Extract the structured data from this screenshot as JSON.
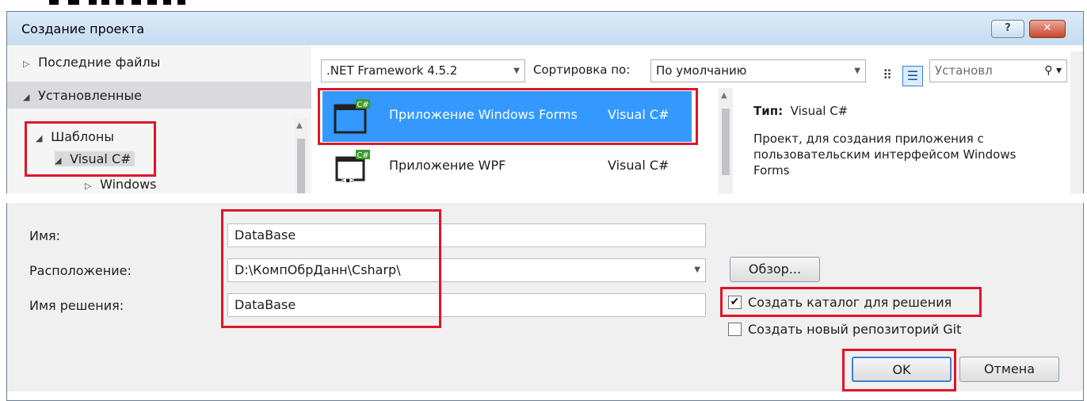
{
  "dialog": {
    "title": "Создание проекта",
    "help_glyph": "?",
    "close_glyph": "✕"
  },
  "sidebar": {
    "items": [
      {
        "label": "Последние файлы",
        "expander": "▷"
      },
      {
        "label": "Установленные",
        "expander": "◢"
      },
      {
        "label": "Шаблоны",
        "expander": "◢"
      },
      {
        "label": "Visual C#",
        "expander": "◢"
      },
      {
        "label": "Windows",
        "expander": "▷"
      }
    ]
  },
  "toolbar": {
    "framework": ".NET Framework 4.5.2",
    "sort_label": "Сортировка по:",
    "sort_value": "По умолчанию",
    "search_placeholder": "Установл"
  },
  "templates": [
    {
      "name": "Приложение Windows Forms",
      "language": "Visual C#",
      "selected": true
    },
    {
      "name": "Приложение WPF",
      "language": "Visual C#",
      "selected": false
    }
  ],
  "description": {
    "type_label": "Тип:",
    "type_value": "Visual C#",
    "text": "Проект, для создания приложения с пользовательским интерфейсом Windows Forms"
  },
  "form": {
    "name_label": "Имя:",
    "name_value": "DataBase",
    "location_label": "Расположение:",
    "location_value": "D:\\КомпОбрДанн\\Csharp\\",
    "solution_label": "Имя решения:",
    "solution_value": "DataBase",
    "browse_label": "Обзор...",
    "create_dir_label": "Создать каталог для решения",
    "create_dir_checked": true,
    "git_label": "Создать новый репозиторий Git",
    "git_checked": false,
    "ok_label": "OK",
    "cancel_label": "Отмена"
  },
  "colors": {
    "highlight_box": "#e0142a",
    "selection": "#3399ff",
    "title_bar": "#c5dcf1"
  }
}
